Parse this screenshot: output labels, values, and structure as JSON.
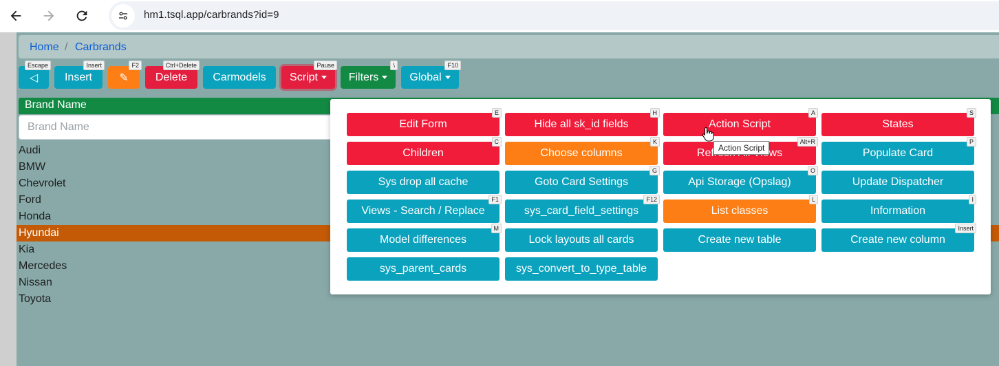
{
  "browser": {
    "url": "hm1.tsql.app/carbrands?id=9",
    "back_icon": "arrow-left-icon",
    "forward_icon": "arrow-right-icon",
    "reload_icon": "reload-icon",
    "site_info_icon": "tune-icon"
  },
  "breadcrumb": {
    "home": "Home",
    "separator": "/",
    "current": "Carbrands"
  },
  "toolbar": {
    "back": {
      "label": "◁",
      "key": "Escape"
    },
    "insert": {
      "label": "Insert",
      "key": "Insert"
    },
    "edit": {
      "label": "✎",
      "key": "F2"
    },
    "delete": {
      "label": "Delete",
      "key": "Ctrl+Delete"
    },
    "carmodels": {
      "label": "Carmodels"
    },
    "script": {
      "label": "Script",
      "key": "Pause"
    },
    "filters": {
      "label": "Filters",
      "key": "\\"
    },
    "global": {
      "label": "Global",
      "key": "F10"
    }
  },
  "grid": {
    "column_header": "Brand Name",
    "search_placeholder": "Brand Name",
    "rows": [
      "Audi",
      "BMW",
      "Chevrolet",
      "Ford",
      "Honda",
      "Hyundai",
      "Kia",
      "Mercedes",
      "Nissan",
      "Toyota"
    ],
    "selected_row": "Hyundai"
  },
  "script_menu": {
    "items": [
      {
        "label": "Edit Form",
        "key": "E",
        "color": "red"
      },
      {
        "label": "Hide all sk_id fields",
        "key": "H",
        "color": "red"
      },
      {
        "label": "Action Script",
        "key": "A",
        "color": "red"
      },
      {
        "label": "States",
        "key": "S",
        "color": "red"
      },
      {
        "label": "Children",
        "key": "C",
        "color": "red"
      },
      {
        "label": "Choose columns",
        "key": "K",
        "color": "orange"
      },
      {
        "label": "Refresh All Views",
        "key": "Alt+R",
        "color": "red"
      },
      {
        "label": "Populate Card",
        "key": "P",
        "color": "teal"
      },
      {
        "label": "Sys drop all cache",
        "key": "",
        "color": "teal"
      },
      {
        "label": "Goto Card Settings",
        "key": "G",
        "color": "teal"
      },
      {
        "label": "Api Storage (Opslag)",
        "key": "O",
        "color": "teal"
      },
      {
        "label": "Update Dispatcher",
        "key": "",
        "color": "teal"
      },
      {
        "label": "Views - Search / Replace",
        "key": "F1",
        "color": "teal"
      },
      {
        "label": "sys_card_field_settings",
        "key": "F12",
        "color": "teal"
      },
      {
        "label": "List classes",
        "key": "L",
        "color": "orange"
      },
      {
        "label": "Information",
        "key": "I",
        "color": "teal"
      },
      {
        "label": "Model differences",
        "key": "M",
        "color": "teal"
      },
      {
        "label": "Lock layouts all cards",
        "key": "",
        "color": "teal"
      },
      {
        "label": "Create new table",
        "key": "",
        "color": "teal"
      },
      {
        "label": "Create new column",
        "key": "Insert",
        "color": "teal"
      },
      {
        "label": "sys_parent_cards",
        "key": "",
        "color": "teal"
      },
      {
        "label": "sys_convert_to_type_table",
        "key": "",
        "color": "teal"
      }
    ],
    "tooltip": "Action Script"
  },
  "colors": {
    "red": "#f01c3a",
    "orange": "#fd7e14",
    "teal": "#0aa2bd",
    "green": "#138a44",
    "selected_row": "#c45a06",
    "page_bg": "#88a9a8"
  }
}
